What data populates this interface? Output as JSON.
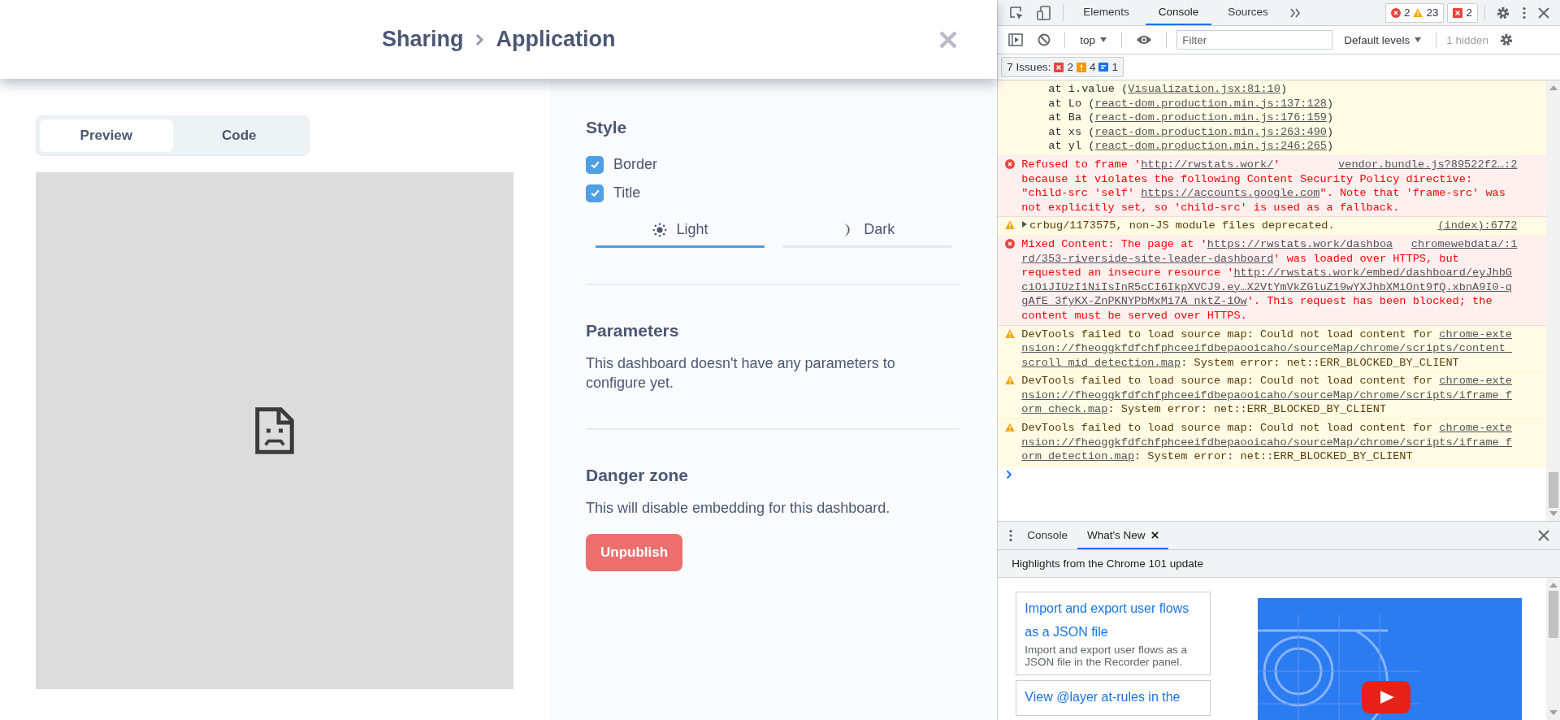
{
  "header": {
    "breadcrumb": [
      "Sharing",
      "Application"
    ]
  },
  "view_tabs": [
    {
      "label": "Preview",
      "selected": true
    },
    {
      "label": "Code",
      "selected": false
    }
  ],
  "style": {
    "title": "Style",
    "options": [
      {
        "label": "Border",
        "checked": true
      },
      {
        "label": "Title",
        "checked": true
      }
    ],
    "themes": [
      {
        "label": "Light",
        "kind": "sun",
        "selected": true
      },
      {
        "label": "Dark",
        "kind": "moon",
        "selected": false
      }
    ]
  },
  "parameters": {
    "title": "Parameters",
    "text": "This dashboard doesn't have any parameters to configure yet."
  },
  "danger": {
    "title": "Danger zone",
    "text": "This will disable embedding for this dashboard.",
    "button": "Unpublish"
  },
  "devtools": {
    "panel_tabs": [
      {
        "label": "Elements",
        "selected": false
      },
      {
        "label": "Console",
        "selected": true
      },
      {
        "label": "Sources",
        "selected": false
      }
    ],
    "counters": {
      "errors": "2",
      "warnings": "23",
      "issues": "2"
    },
    "toolbar": {
      "context": "top",
      "filter_placeholder": "Filter",
      "levels": "Default levels",
      "hidden": "1 hidden"
    },
    "issues": {
      "label": "7 Issues:",
      "errors": "2",
      "warnings": "4",
      "info": "1"
    },
    "messages": [
      {
        "kind": "stack",
        "lines": [
          {
            "parts": [
              {
                "text": "at i.value (",
                "link": false
              },
              {
                "text": "Visualization.jsx:81:10",
                "link": true
              },
              {
                "text": ")",
                "link": false
              }
            ]
          },
          {
            "parts": [
              {
                "text": "at Lo (",
                "link": false
              },
              {
                "text": "react-dom.production.min.js:137:128",
                "link": true
              },
              {
                "text": ")",
                "link": false
              }
            ]
          },
          {
            "parts": [
              {
                "text": "at Ba (",
                "link": false
              },
              {
                "text": "react-dom.production.min.js:176:159",
                "link": true
              },
              {
                "text": ")",
                "link": false
              }
            ]
          },
          {
            "parts": [
              {
                "text": "at xs (",
                "link": false
              },
              {
                "text": "react-dom.production.min.js:263:490",
                "link": true
              },
              {
                "text": ")",
                "link": false
              }
            ]
          },
          {
            "parts": [
              {
                "text": "at yl (",
                "link": false
              },
              {
                "text": "react-dom.production.min.js:246:265",
                "link": true
              },
              {
                "text": ")",
                "link": false
              }
            ]
          }
        ]
      },
      {
        "kind": "error",
        "source": "vendor.bundle.js?89522f2…:2",
        "lines": [
          {
            "parts": [
              {
                "text": "Refused to frame '",
                "link": false
              },
              {
                "text": "http://rwstats.work/",
                "link": true
              },
              {
                "text": "'",
                "link": false
              }
            ]
          },
          {
            "parts": [
              {
                "text": "because it violates the following Content Security Policy directive:",
                "link": false
              }
            ]
          },
          {
            "parts": [
              {
                "text": "\"child-src 'self' ",
                "link": false
              },
              {
                "text": "https://accounts.google.com",
                "link": true
              },
              {
                "text": "\". Note that 'frame-src' was",
                "link": false
              }
            ]
          },
          {
            "parts": [
              {
                "text": "not explicitly set, so 'child-src' is used as a fallback.",
                "link": false
              }
            ]
          }
        ]
      },
      {
        "kind": "warning",
        "expandable": true,
        "source": "(index):6772",
        "lines": [
          {
            "parts": [
              {
                "text": "crbug/1173575, non-JS module files deprecated.",
                "link": false
              }
            ]
          }
        ]
      },
      {
        "kind": "error",
        "source": "chromewebdata/:1",
        "lines": [
          {
            "parts": [
              {
                "text": "Mixed Content: The page at '",
                "link": false
              },
              {
                "text": "https://rwstats.work/dashboa",
                "link": true
              }
            ]
          },
          {
            "parts": [
              {
                "text": "rd/353-riverside-site-leader-dashboard",
                "link": true
              },
              {
                "text": "' was loaded over HTTPS, but",
                "link": false
              }
            ]
          },
          {
            "parts": [
              {
                "text": "requested an insecure resource '",
                "link": false
              },
              {
                "text": "http://rwstats.work/embed/dashboard/eyJhbG",
                "link": true
              }
            ]
          },
          {
            "parts": [
              {
                "text": "ciOiJIUzI1NiIsInR5cCI6IkpXVCJ9.ey…X2VtYmVkZGluZ19wYXJhbXMiOnt9fQ.xbnA9I0-q",
                "link": true
              }
            ]
          },
          {
            "parts": [
              {
                "text": "gAfE_3fyKX-ZnPKNYPbMxMi7A_nktZ-1Ow",
                "link": true
              },
              {
                "text": "'. This request has been blocked; the",
                "link": false
              }
            ]
          },
          {
            "parts": [
              {
                "text": "content must be served over HTTPS.",
                "link": false
              }
            ]
          }
        ]
      },
      {
        "kind": "warning",
        "lines": [
          {
            "parts": [
              {
                "text": "DevTools failed to load source map: Could not load content for ",
                "link": false
              },
              {
                "text": "chrome-exte",
                "link": true
              }
            ]
          },
          {
            "parts": [
              {
                "text": "nsion://fheoggkfdfchfphceeifdbepaooicaho/sourceMap/chrome/scripts/content_",
                "link": true
              }
            ]
          },
          {
            "parts": [
              {
                "text": "scroll_mid_detection.map",
                "link": true
              },
              {
                "text": ": System error: net::ERR_BLOCKED_BY_CLIENT",
                "link": false
              }
            ]
          }
        ]
      },
      {
        "kind": "warning",
        "lines": [
          {
            "parts": [
              {
                "text": "DevTools failed to load source map: Could not load content for ",
                "link": false
              },
              {
                "text": "chrome-exte",
                "link": true
              }
            ]
          },
          {
            "parts": [
              {
                "text": "nsion://fheoggkfdfchfphceeifdbepaooicaho/sourceMap/chrome/scripts/iframe_f",
                "link": true
              }
            ]
          },
          {
            "parts": [
              {
                "text": "orm_check.map",
                "link": true
              },
              {
                "text": ": System error: net::ERR_BLOCKED_BY_CLIENT",
                "link": false
              }
            ]
          }
        ]
      },
      {
        "kind": "warning",
        "lines": [
          {
            "parts": [
              {
                "text": "DevTools failed to load source map: Could not load content for ",
                "link": false
              },
              {
                "text": "chrome-exte",
                "link": true
              }
            ]
          },
          {
            "parts": [
              {
                "text": "nsion://fheoggkfdfchfphceeifdbepaooicaho/sourceMap/chrome/scripts/iframe_f",
                "link": true
              }
            ]
          },
          {
            "parts": [
              {
                "text": "orm_detection.map",
                "link": true
              },
              {
                "text": ": System error: net::ERR_BLOCKED_BY_CLIENT",
                "link": false
              }
            ]
          }
        ]
      }
    ],
    "drawer": {
      "tabs": [
        {
          "label": "Console",
          "selected": false,
          "closable": false
        },
        {
          "label": "What's New",
          "selected": true,
          "closable": true
        }
      ],
      "highlights": "Highlights from the Chrome 101 update",
      "cards": [
        {
          "title": "Import and export user flows as a JSON file",
          "description": "Import and export user flows as a JSON file in the Recorder panel."
        },
        {
          "title": "View @layer at-rules in the"
        }
      ]
    }
  }
}
